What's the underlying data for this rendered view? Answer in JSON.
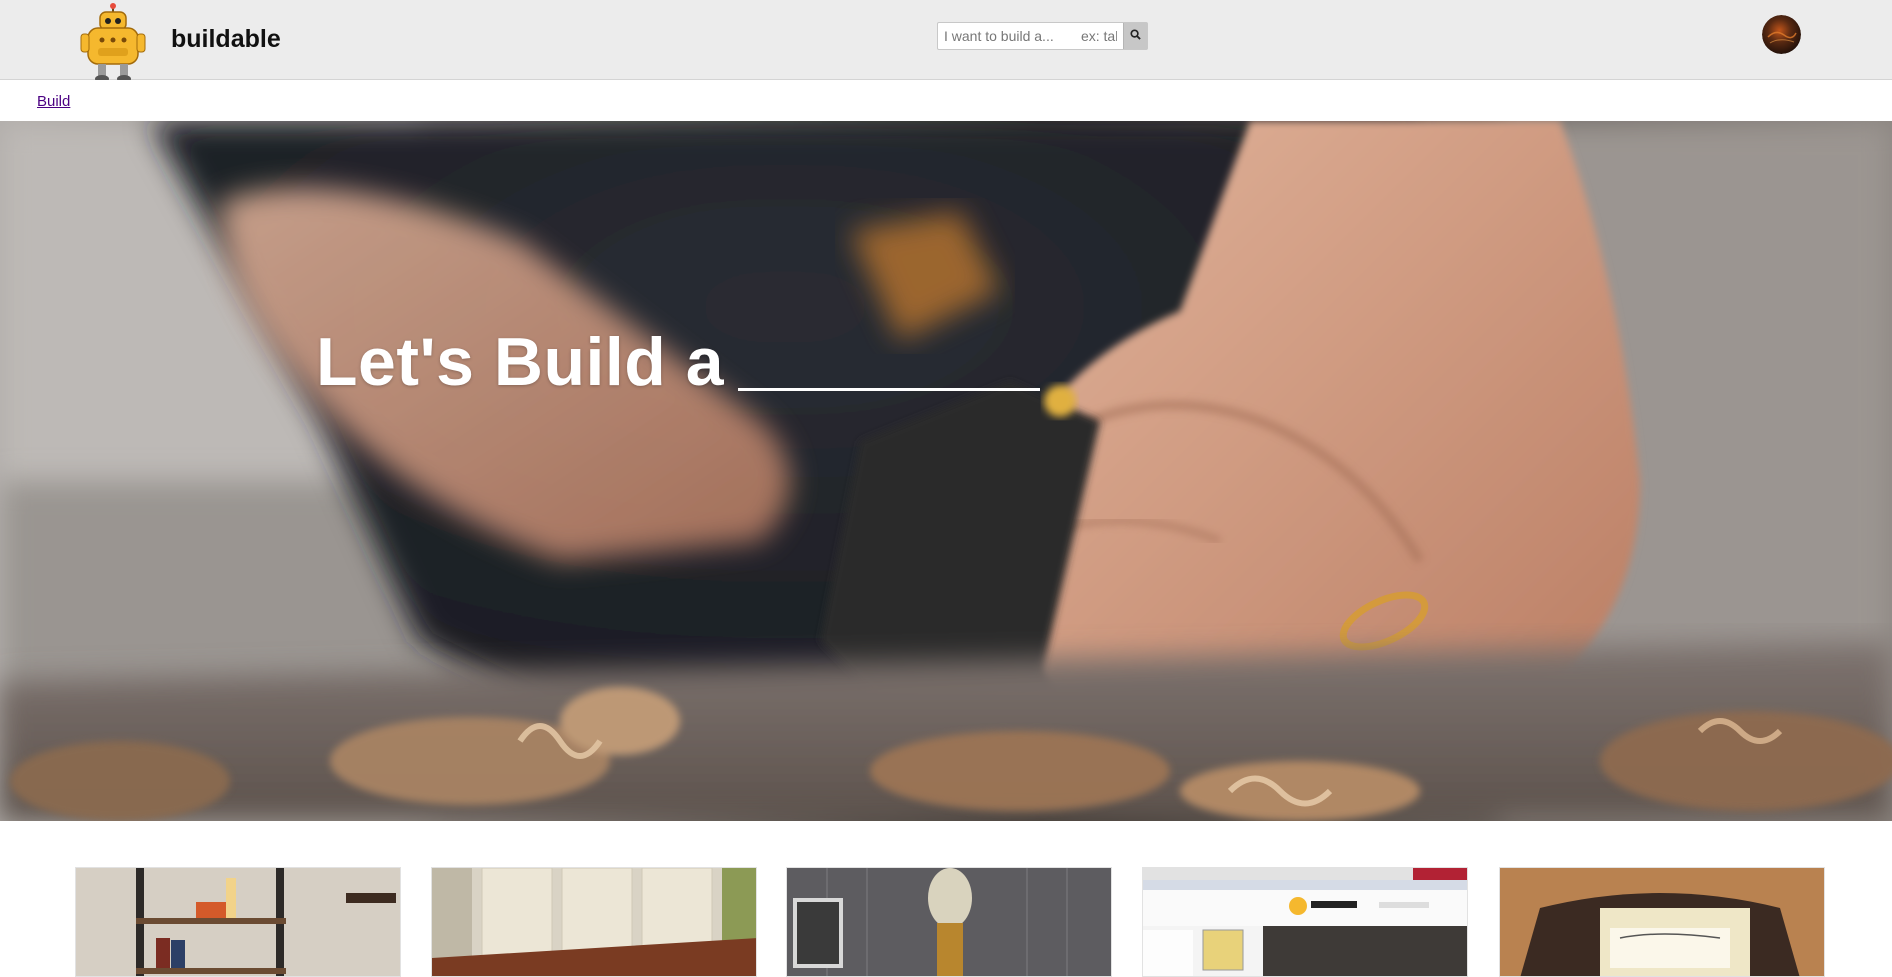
{
  "header": {
    "brand": "buildable",
    "search_placeholder": "I want to build a...       ex: table",
    "logo_icon": "robot-mascot-icon",
    "search_icon": "search-icon",
    "avatar_icon": "user-avatar-icon"
  },
  "subnav": {
    "build_link": "Build"
  },
  "hero": {
    "title": "Let's Build a"
  },
  "cards": [
    {
      "name": "shelf-project"
    },
    {
      "name": "bench-project"
    },
    {
      "name": "lamp-project"
    },
    {
      "name": "instructables-screenshot"
    },
    {
      "name": "soap-project"
    }
  ],
  "colors": {
    "topbar": "#ececec",
    "link": "#4b0082",
    "hero_text": "#ffffff"
  }
}
